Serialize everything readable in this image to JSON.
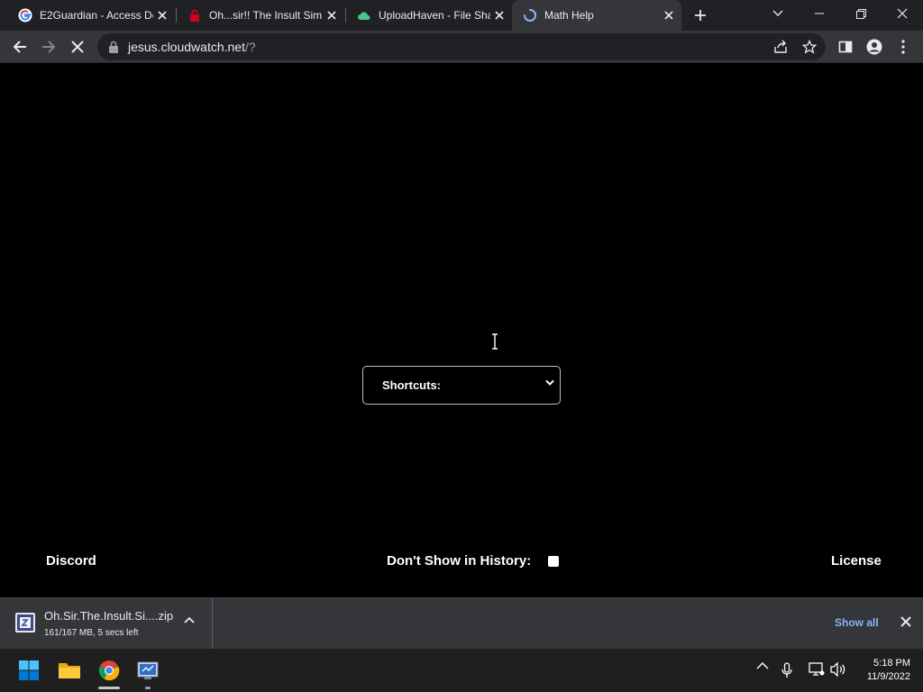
{
  "browser": {
    "tabs": [
      {
        "title": "E2Guardian - Access De",
        "icon": "google-icon",
        "active": false
      },
      {
        "title": "Oh...sir!! The Insult Sim",
        "icon": "lock-icon",
        "active": false
      },
      {
        "title": "UploadHaven - File Sha",
        "icon": "cloud-icon",
        "active": false
      },
      {
        "title": "Math Help",
        "icon": "loading-spinner-icon",
        "active": true
      }
    ],
    "url_host": "jesus.cloudwatch.net",
    "url_rest": "/?"
  },
  "page": {
    "shortcuts_label": "Shortcuts:",
    "discord_label": "Discord",
    "history_label": "Don't Show in History:",
    "license_label": "License"
  },
  "download": {
    "filename": "Oh.Sir.The.Insult.Si....zip",
    "status": "161/167 MB, 5 secs left",
    "show_all": "Show all"
  },
  "taskbar": {
    "time": "5:18 PM",
    "date": "11/9/2022"
  },
  "colors": {
    "accent_link": "#8ab4f8",
    "toolbar": "#35363a",
    "tabstrip": "#202124"
  }
}
